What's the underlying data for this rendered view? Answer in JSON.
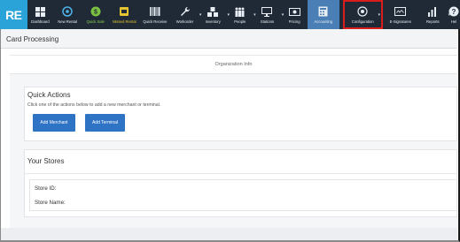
{
  "app": {
    "logo": "RE",
    "page_title": "Card Processing"
  },
  "nav": {
    "items": [
      {
        "label": "Dashboard",
        "icon": "dashboard-icon"
      },
      {
        "label": "New Rental",
        "icon": "new-rental-icon"
      },
      {
        "label": "Quick Sale",
        "icon": "quick-sale-icon"
      },
      {
        "label": "Missed Rental",
        "icon": "missed-rental-icon"
      },
      {
        "label": "Quick Receive",
        "icon": "barcode-icon"
      },
      {
        "label": "Workorder",
        "icon": "wrench-icon"
      },
      {
        "label": "Inventory",
        "icon": "inventory-icon"
      },
      {
        "label": "People",
        "icon": "people-icon"
      },
      {
        "label": "Stations",
        "icon": "monitor-icon"
      },
      {
        "label": "Pricing",
        "icon": "pricing-icon"
      },
      {
        "label": "Accounting",
        "icon": "accounting-icon"
      },
      {
        "label": "Configuration",
        "icon": "configuration-icon"
      },
      {
        "label": "E-Signatures",
        "icon": "e-signature-icon"
      },
      {
        "label": "Reports",
        "icon": "reports-icon"
      },
      {
        "label": "Hel",
        "icon": "help-icon"
      }
    ]
  },
  "org_info": {
    "label": "Organization Info"
  },
  "quick_actions": {
    "title": "Quick Actions",
    "description": "Click one of the actions below to add a new merchant or terminal.",
    "add_merchant": "Add Merchant",
    "add_terminal": "Add Terminal"
  },
  "stores": {
    "title": "Your Stores",
    "store_id_label": "Store ID:",
    "store_name_label": "Store Name:"
  },
  "colors": {
    "nav_bg": "#1f2a36",
    "logo_bg": "#2aa3d8",
    "active_bg": "#4a7fb5",
    "highlight": "#d91c1c",
    "button": "#2f73c4"
  }
}
